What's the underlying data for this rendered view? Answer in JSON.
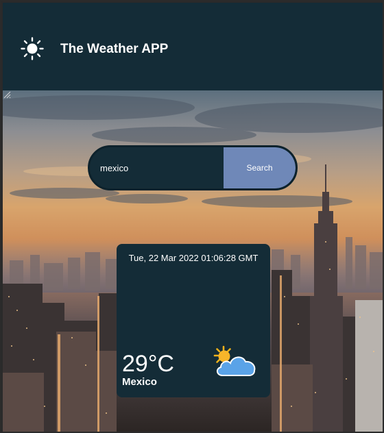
{
  "header": {
    "icon": "sun-icon",
    "title": "The Weather APP",
    "background": "#142c37"
  },
  "search": {
    "value": "mexico",
    "button_label": "Search",
    "button_color": "#6f88b8"
  },
  "weather_card": {
    "datetime": "Tue, 22 Mar 2022 01:06:28 GMT",
    "temperature": "29°C",
    "city": "Mexico",
    "icon": "partly-cloudy-icon"
  },
  "background_image": "city-skyline-sunset-photo"
}
